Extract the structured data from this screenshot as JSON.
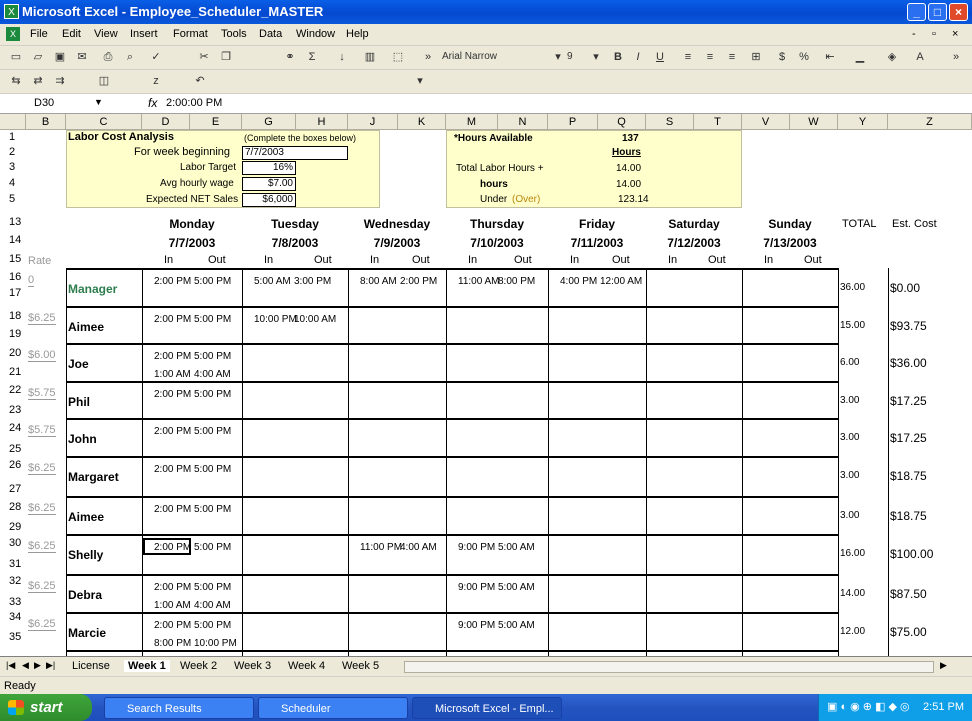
{
  "window": {
    "title": "Microsoft Excel - Employee_Scheduler_MASTER"
  },
  "menu": [
    "File",
    "Edit",
    "View",
    "Insert",
    "Format",
    "Tools",
    "Data",
    "Window",
    "Help"
  ],
  "format_toolbar": {
    "font": "Arial Narrow",
    "size": "9"
  },
  "formula_bar": {
    "name_box": "D30",
    "fx": "fx",
    "value": "2:00:00 PM"
  },
  "columns": [
    "B",
    "C",
    "D",
    "E",
    "G",
    "H",
    "J",
    "K",
    "M",
    "N",
    "P",
    "Q",
    "S",
    "T",
    "V",
    "W",
    "Y",
    "Z"
  ],
  "rows": [
    "1",
    "2",
    "3",
    "4",
    "5",
    "13",
    "14",
    "15",
    "16",
    "17",
    "18",
    "19",
    "20",
    "21",
    "22",
    "23",
    "24",
    "25",
    "26",
    "27",
    "28",
    "29",
    "30",
    "31",
    "32",
    "33",
    "34",
    "35"
  ],
  "labor": {
    "title": "Labor Cost Analysis",
    "note": "(Complete the boxes below)",
    "week_label": "For week beginning",
    "week_value": "7/7/2003",
    "target_label": "Labor Target",
    "target_value": "16%",
    "wage_label": "Avg hourly wage",
    "wage_value": "$7.00",
    "sales_label": "Expected NET Sales",
    "sales_value": "$6,000"
  },
  "hours": {
    "avail_label": "*Hours Available",
    "avail_value": "137",
    "hours_unit": "Hours",
    "total_label": "Total Labor Hours +",
    "total_value": "14.00",
    "hours_label": "hours",
    "hours_value": "14.00",
    "under_label": "Under",
    "under_paren": "(Over)",
    "under_value": "123.14"
  },
  "days": [
    {
      "name": "Monday",
      "date": "7/7/2003"
    },
    {
      "name": "Tuesday",
      "date": "7/8/2003"
    },
    {
      "name": "Wednesday",
      "date": "7/9/2003"
    },
    {
      "name": "Thursday",
      "date": "7/10/2003"
    },
    {
      "name": "Friday",
      "date": "7/11/2003"
    },
    {
      "name": "Saturday",
      "date": "7/12/2003"
    },
    {
      "name": "Sunday",
      "date": "7/13/2003"
    }
  ],
  "in_label": "In",
  "out_label": "Out",
  "rate_label": "Rate",
  "total_header": "TOTAL",
  "cost_header": "Est. Cost",
  "employees": [
    {
      "name": "Manager",
      "rate": "0",
      "total": "36.00",
      "cost": "$0.00",
      "shifts": [
        [
          "2:00 PM",
          "5:00 PM"
        ],
        [
          "5:00 AM",
          "3:00 PM"
        ],
        [
          "8:00 AM",
          "2:00 PM"
        ],
        [
          "11:00 AM",
          "8:00 PM"
        ],
        [
          "4:00 PM",
          "12:00 AM"
        ],
        [
          "",
          ""
        ],
        [
          "",
          ""
        ]
      ],
      "shifts2": []
    },
    {
      "name": "Aimee",
      "rate": "$6.25",
      "total": "15.00",
      "cost": "$93.75",
      "shifts": [
        [
          "2:00 PM",
          "5:00 PM"
        ],
        [
          "10:00 PM",
          "10:00 AM"
        ],
        [
          "",
          ""
        ],
        [
          "",
          ""
        ],
        [
          "",
          ""
        ],
        [
          "",
          ""
        ],
        [
          "",
          ""
        ]
      ],
      "shifts2": []
    },
    {
      "name": "Joe",
      "rate": "$6.00",
      "total": "6.00",
      "cost": "$36.00",
      "shifts": [
        [
          "2:00 PM",
          "5:00 PM"
        ],
        [
          "",
          ""
        ],
        [
          "",
          ""
        ],
        [
          "",
          ""
        ],
        [
          "",
          ""
        ],
        [
          "",
          ""
        ],
        [
          "",
          ""
        ]
      ],
      "shifts2": [
        [
          "1:00 AM",
          "4:00 AM"
        ]
      ]
    },
    {
      "name": "Phil",
      "rate": "$5.75",
      "total": "3.00",
      "cost": "$17.25",
      "shifts": [
        [
          "2:00 PM",
          "5:00 PM"
        ],
        [
          "",
          ""
        ],
        [
          "",
          ""
        ],
        [
          "",
          ""
        ],
        [
          "",
          ""
        ],
        [
          "",
          ""
        ],
        [
          "",
          ""
        ]
      ],
      "shifts2": []
    },
    {
      "name": "John",
      "rate": "$5.75",
      "total": "3.00",
      "cost": "$17.25",
      "shifts": [
        [
          "2:00 PM",
          "5:00 PM"
        ],
        [
          "",
          ""
        ],
        [
          "",
          ""
        ],
        [
          "",
          ""
        ],
        [
          "",
          ""
        ],
        [
          "",
          ""
        ],
        [
          "",
          ""
        ]
      ],
      "shifts2": []
    },
    {
      "name": "Margaret",
      "rate": "$6.25",
      "total": "3.00",
      "cost": "$18.75",
      "shifts": [
        [
          "2:00 PM",
          "5:00 PM"
        ],
        [
          "",
          ""
        ],
        [
          "",
          ""
        ],
        [
          "",
          ""
        ],
        [
          "",
          ""
        ],
        [
          "",
          ""
        ],
        [
          "",
          ""
        ]
      ],
      "shifts2": []
    },
    {
      "name": "Aimee",
      "rate": "$6.25",
      "total": "3.00",
      "cost": "$18.75",
      "shifts": [
        [
          "2:00 PM",
          "5:00 PM"
        ],
        [
          "",
          ""
        ],
        [
          "",
          ""
        ],
        [
          "",
          ""
        ],
        [
          "",
          ""
        ],
        [
          "",
          ""
        ],
        [
          "",
          ""
        ]
      ],
      "shifts2": []
    },
    {
      "name": "Shelly",
      "rate": "$6.25",
      "total": "16.00",
      "cost": "$100.00",
      "shifts": [
        [
          "2:00 PM",
          "5:00 PM"
        ],
        [
          "",
          ""
        ],
        [
          "11:00 PM",
          "4:00 AM"
        ],
        [
          "9:00 PM",
          "5:00 AM"
        ],
        [
          "",
          ""
        ],
        [
          "",
          ""
        ],
        [
          "",
          ""
        ]
      ],
      "shifts2": []
    },
    {
      "name": "Debra",
      "rate": "$6.25",
      "total": "14.00",
      "cost": "$87.50",
      "shifts": [
        [
          "2:00 PM",
          "5:00 PM"
        ],
        [
          "",
          ""
        ],
        [
          "",
          ""
        ],
        [
          "9:00 PM",
          "5:00 AM"
        ],
        [
          "",
          ""
        ],
        [
          "",
          ""
        ],
        [
          "",
          ""
        ]
      ],
      "shifts2": [
        [
          "1:00 AM",
          "4:00 AM"
        ]
      ]
    },
    {
      "name": "Marcie",
      "rate": "$6.25",
      "total": "12.00",
      "cost": "$75.00",
      "shifts": [
        [
          "2:00 PM",
          "5:00 PM"
        ],
        [
          "",
          ""
        ],
        [
          "",
          ""
        ],
        [
          "9:00 PM",
          "5:00 AM"
        ],
        [
          "",
          ""
        ],
        [
          "",
          ""
        ],
        [
          "",
          ""
        ]
      ],
      "shifts2": [
        [
          "8:00 PM",
          "10:00 PM"
        ]
      ]
    }
  ],
  "sheets": [
    "License",
    "Week 1",
    "Week 2",
    "Week 3",
    "Week 4",
    "Week 5"
  ],
  "status": "Ready",
  "taskbar": {
    "start": "start",
    "items": [
      "Search Results",
      "Scheduler",
      "Microsoft Excel - Empl..."
    ],
    "clock": "2:51 PM"
  },
  "colors": {
    "title_blue": "#0449d1",
    "note_yellow": "#ffffcc",
    "manager_green": "#2e7d4f",
    "tan_text": "#b8860b"
  }
}
